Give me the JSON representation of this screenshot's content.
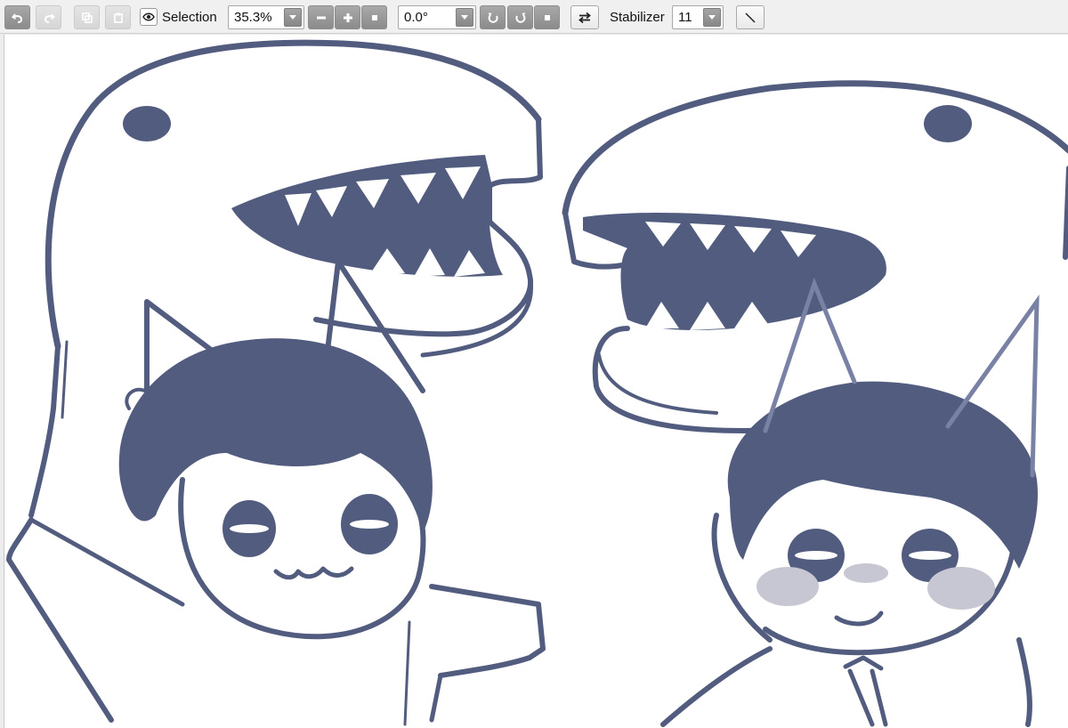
{
  "toolbar": {
    "selection_label": "Selection",
    "zoom_value": "35.3%",
    "rotation_value": "0.0°",
    "stabilizer_label": "Stabilizer",
    "stabilizer_value": "11"
  },
  "icons": {
    "undo": "undo-icon",
    "redo": "redo-icon",
    "eye": "eye-icon",
    "zoom_out": "minus-icon",
    "zoom_in": "plus-icon",
    "zoom_reset": "square-icon",
    "rotate_left": "rotate-left-icon",
    "rotate_right": "rotate-right-icon",
    "rotate_reset": "square-icon",
    "flip": "flip-arrows-icon",
    "pen": "pen-line-icon"
  },
  "colors": {
    "ink": "#525c7e",
    "blush": "#c7c7d3",
    "ear": "#7982a4",
    "toolbar_bg": "#f0f0f0"
  }
}
